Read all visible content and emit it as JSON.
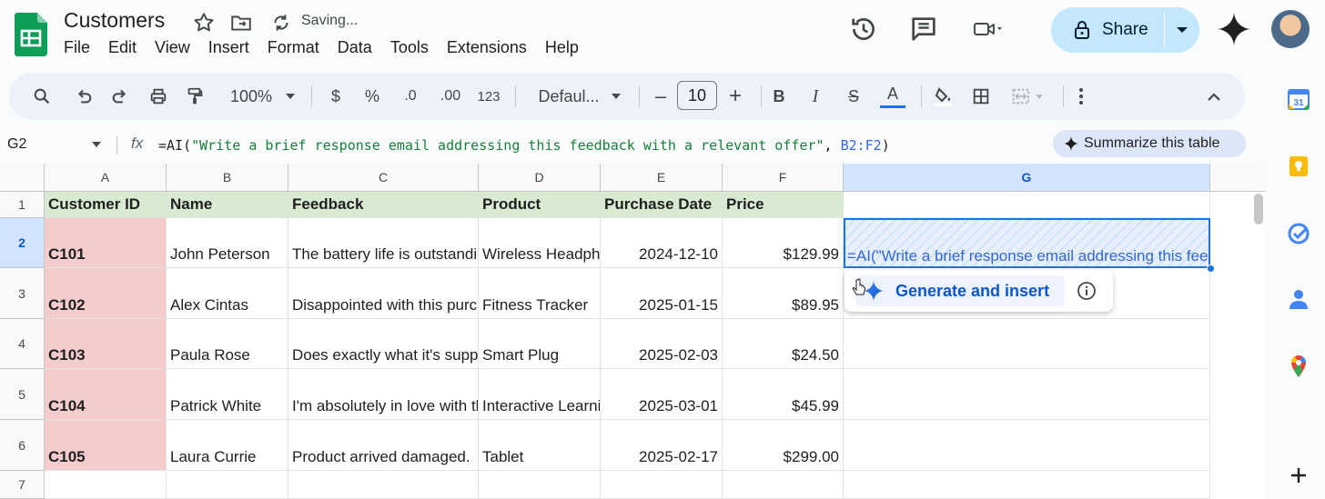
{
  "header": {
    "doc_title": "Customers",
    "status": "Saving...",
    "share_label": "Share"
  },
  "menu": [
    "File",
    "Edit",
    "View",
    "Insert",
    "Format",
    "Data",
    "Tools",
    "Extensions",
    "Help"
  ],
  "toolbar": {
    "zoom": "100%",
    "currency": "$",
    "percent": "%",
    "dec_decrease": ".0",
    "dec_increase": ".00",
    "number_format": "123",
    "font": "Defaul...",
    "font_size": "10",
    "bold": "B",
    "italic": "I",
    "strike": "S",
    "text_color": "A",
    "text_color_swatch": "#1a73e8"
  },
  "formula_bar": {
    "cell_ref": "G2",
    "fx": "fx",
    "formula_fn": "=AI(",
    "formula_str": "\"Write a brief response email addressing this feedback with a relevant offer\"",
    "formula_sep": ", ",
    "formula_ref": "B2:F2",
    "formula_end": ")"
  },
  "summarize_label": "Summarize this table",
  "columns": [
    "A",
    "B",
    "C",
    "D",
    "E",
    "F",
    "G"
  ],
  "rows": [
    "1",
    "2",
    "3",
    "4",
    "5",
    "6",
    "7"
  ],
  "table": {
    "headers": [
      "Customer ID",
      "Name",
      "Feedback",
      "Product",
      "Purchase Date",
      "Price"
    ],
    "data": [
      [
        "C101",
        "John Peterson",
        "The battery life is outstanding",
        "Wireless Headphones",
        "2024-12-10",
        "$129.99"
      ],
      [
        "C102",
        "Alex Cintas",
        "Disappointed with this purchase",
        "Fitness Tracker",
        "2025-01-15",
        "$89.95"
      ],
      [
        "C103",
        "Paula Rose",
        "Does exactly what it's supposed to",
        "Smart Plug",
        "2025-02-03",
        "$24.50"
      ],
      [
        "C104",
        "Patrick White",
        "I'm absolutely in love with this",
        "Interactive Learning",
        "2025-03-01",
        "$45.99"
      ],
      [
        "C105",
        "Laura Currie",
        "Product arrived damaged.",
        "Tablet",
        "2025-02-17",
        "$299.00"
      ]
    ]
  },
  "selected_cell_text": "=AI(\"Write a brief response email addressing this feedback with a relevant offer\", B2:F2)",
  "generate_label": "Generate and insert",
  "colors": {
    "header_fill": "#d9ead3",
    "id_fill": "#f4cccc",
    "selection": "#1a73e8",
    "share_bg": "#c2e7ff"
  }
}
